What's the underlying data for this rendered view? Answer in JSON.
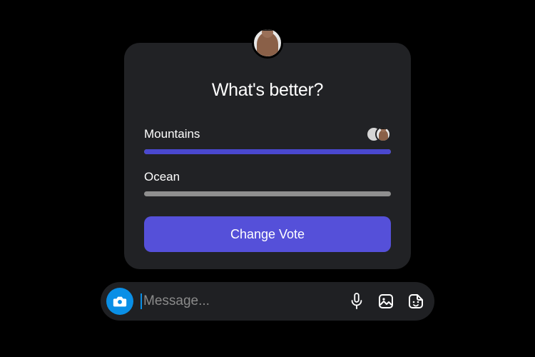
{
  "poll": {
    "title": "What's better?",
    "options": [
      {
        "label": "Mountains",
        "percent": 100,
        "color": "#4a48cf"
      },
      {
        "label": "Ocean",
        "percent": 0,
        "color": "#8f8f8f"
      }
    ],
    "button_label": "Change Vote"
  },
  "composer": {
    "placeholder": "Message..."
  },
  "colors": {
    "accent": "#5550d9",
    "camera": "#0a8fe6",
    "card": "#212225"
  }
}
